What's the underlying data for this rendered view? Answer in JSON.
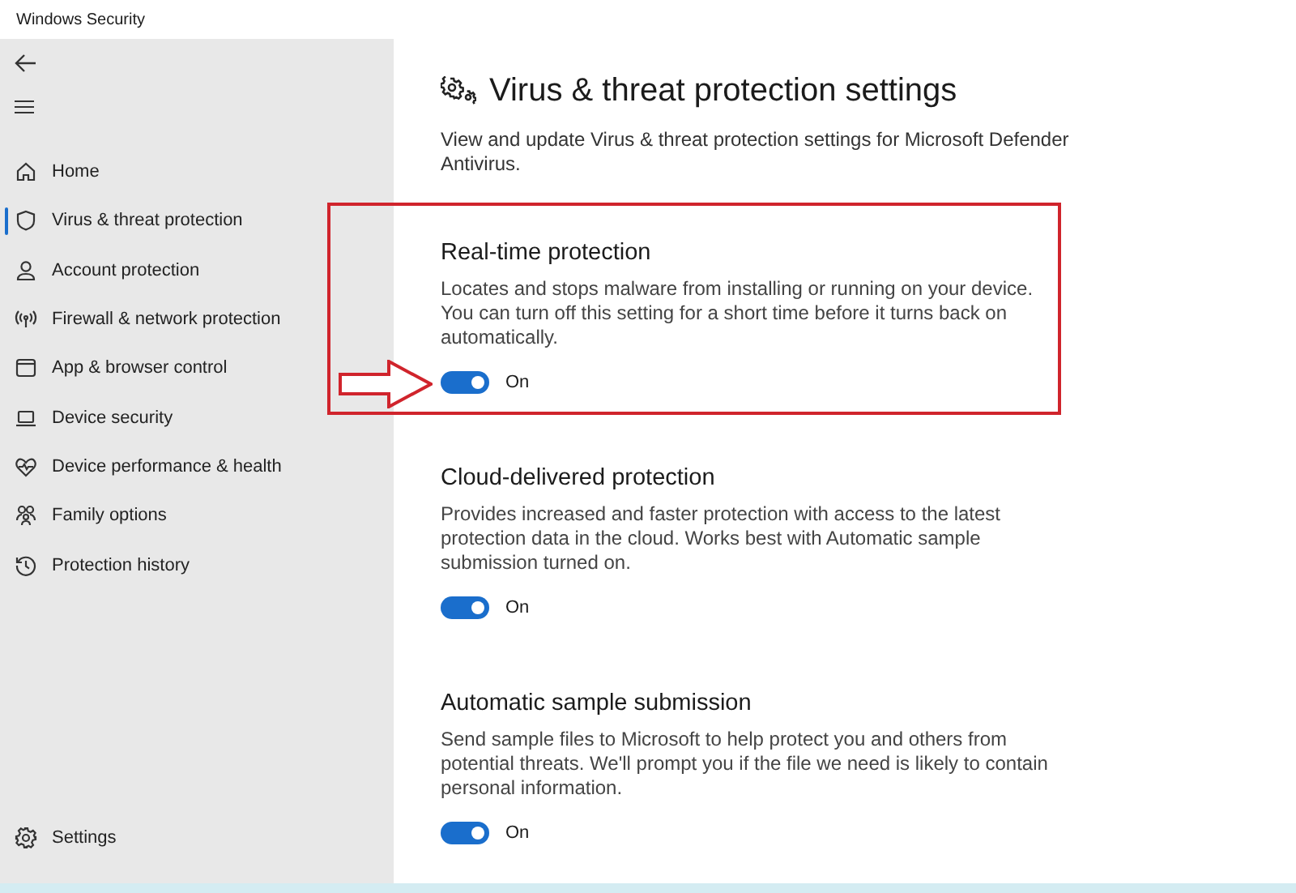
{
  "window": {
    "title": "Windows Security"
  },
  "sidebar": {
    "items": [
      {
        "label": "Home",
        "selected": false
      },
      {
        "label": "Virus & threat protection",
        "selected": true
      },
      {
        "label": "Account protection",
        "selected": false
      },
      {
        "label": "Firewall & network protection",
        "selected": false
      },
      {
        "label": "App & browser control",
        "selected": false
      },
      {
        "label": "Device security",
        "selected": false
      },
      {
        "label": "Device performance & health",
        "selected": false
      },
      {
        "label": "Family options",
        "selected": false
      },
      {
        "label": "Protection history",
        "selected": false
      }
    ],
    "settings_item": {
      "label": "Settings",
      "selected": false
    }
  },
  "page": {
    "title": "Virus & threat protection settings",
    "description": "View and update Virus & threat protection settings for Microsoft Defender Antivirus."
  },
  "settings": [
    {
      "title": "Real-time protection",
      "description": "Locates and stops malware from installing or running on your device. You can turn off this setting for a short time before it turns back on automatically.",
      "on": true,
      "state_label": "On",
      "highlighted": true
    },
    {
      "title": "Cloud-delivered protection",
      "description": "Provides increased and faster protection with access to the latest protection data in the cloud. Works best with Automatic sample submission turned on.",
      "on": true,
      "state_label": "On",
      "highlighted": false
    },
    {
      "title": "Automatic sample submission",
      "description": "Send sample files to Microsoft to help protect you and others from potential threats. We'll prompt you if the file we need is likely to contain personal information.",
      "on": true,
      "state_label": "On",
      "highlighted": false
    }
  ]
}
